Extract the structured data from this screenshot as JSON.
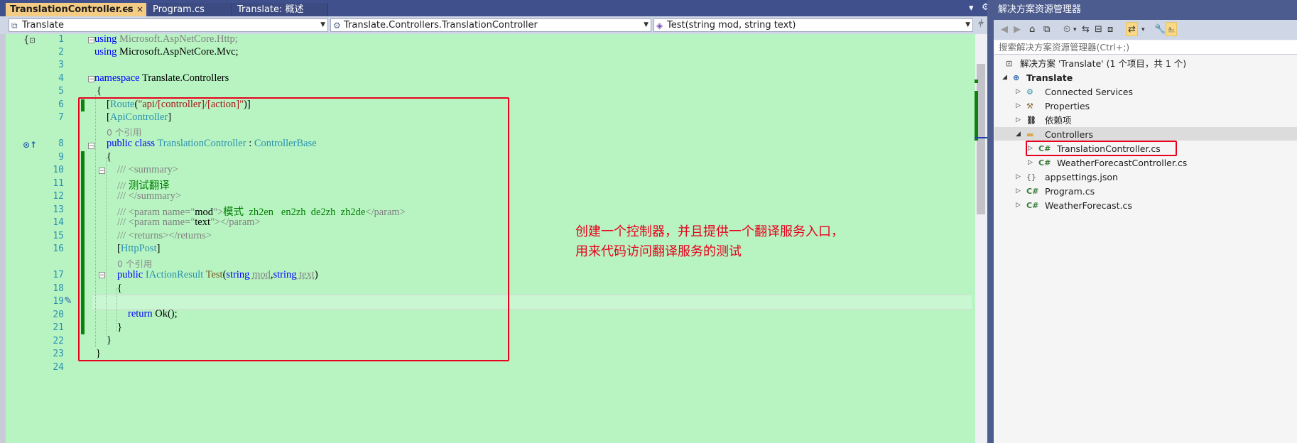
{
  "tabs": [
    {
      "label": "TranslationController.cs",
      "active": true,
      "pin": "⊸",
      "close": "×"
    },
    {
      "label": "Program.cs",
      "active": false
    },
    {
      "label": "Translate: 概述",
      "active": false
    }
  ],
  "tab_overflow": "▾",
  "tab_settings": "⚙",
  "nav": {
    "project": "Translate",
    "class": "Translate.Controllers.TranslationController",
    "member": "Test(string mod, string text)"
  },
  "line_numbers": [
    "1",
    "2",
    "3",
    "4",
    "5",
    "6",
    "7",
    "8",
    "9",
    "10",
    "11",
    "12",
    "13",
    "14",
    "15",
    "16",
    "17",
    "18",
    "19",
    "20",
    "21",
    "22",
    "23",
    "24"
  ],
  "code": {
    "l1": {
      "kw": "using",
      "rest": " Microsoft.AspNetCore.Http;"
    },
    "l2": {
      "kw": "using",
      "rest": " Microsoft.AspNetCore.Mvc;"
    },
    "l4": {
      "kw": "namespace",
      "rest": " Translate.Controllers"
    },
    "l5": "{",
    "l6": {
      "b1": "[",
      "attr": "Route",
      "p1": "(",
      "str": "\"api/[controller]/[action]\"",
      "p2": ")]"
    },
    "l7": {
      "b1": "[",
      "attr": "ApiController",
      "b2": "]"
    },
    "ref1": "0 个引用",
    "l8": {
      "kw": "public class",
      "name": " TranslationController",
      "sep": " : ",
      "base": "ControllerBase"
    },
    "l9": "{",
    "l10": {
      "sl": "/// ",
      "tag": "<summary>"
    },
    "l11": {
      "sl": "/// ",
      "text": "测试翻译"
    },
    "l12": {
      "sl": "/// ",
      "tag": "</summary>"
    },
    "l13": {
      "sl": "/// ",
      "tag1": "<param name=\"",
      "val": "mod",
      "tag2": "\">",
      "text": "模式  zh2en   en2zh  de2zh  zh2de",
      "tag3": "</param>"
    },
    "l14": {
      "sl": "/// ",
      "tag1": "<param name=\"",
      "val": "text",
      "tag2": "\"></param>"
    },
    "l15": {
      "sl": "/// ",
      "tag": "<returns></returns>"
    },
    "l16": {
      "b1": "[",
      "attr": "HttpPost",
      "b2": "]"
    },
    "ref2": "0 个引用",
    "l17": {
      "kw": "public",
      "sp": " ",
      "type": "IActionResult",
      "name": " Test",
      "p1": "(",
      "kw2": "string",
      "a1": " mod",
      "c": ",",
      "kw3": "string",
      "a2": " text",
      "p2": ")"
    },
    "l18": "{",
    "l20": {
      "kw": "return",
      "rest": " Ok();"
    },
    "l21": "}",
    "l22": "}",
    "l23": "}"
  },
  "annotation": "创建一个控制器，并且提供一个翻译服务入口，\n用来代码访问翻译服务的测试",
  "solution_explorer": {
    "title": "解决方案资源管理器",
    "search_placeholder": "搜索解决方案资源管理器(Ctrl+;)",
    "solution": "解决方案 'Translate' (1 个项目，共 1 个)",
    "project": "Translate",
    "items": [
      {
        "label": "Connected Services"
      },
      {
        "label": "Properties"
      },
      {
        "label": "依赖项"
      },
      {
        "label": "Controllers"
      },
      {
        "label": "TranslationController.cs"
      },
      {
        "label": "WeatherForecastController.cs"
      },
      {
        "label": "appsettings.json"
      },
      {
        "label": "Program.cs"
      },
      {
        "label": "WeatherForecast.cs"
      }
    ]
  },
  "colors": {
    "editor_bg": "#b8f4c2",
    "keyword": "#0000ff",
    "type": "#2b91af",
    "string": "#a31515",
    "comment": "#008000",
    "annotation": "#e8001c",
    "active_tab": "#f5cc84"
  }
}
